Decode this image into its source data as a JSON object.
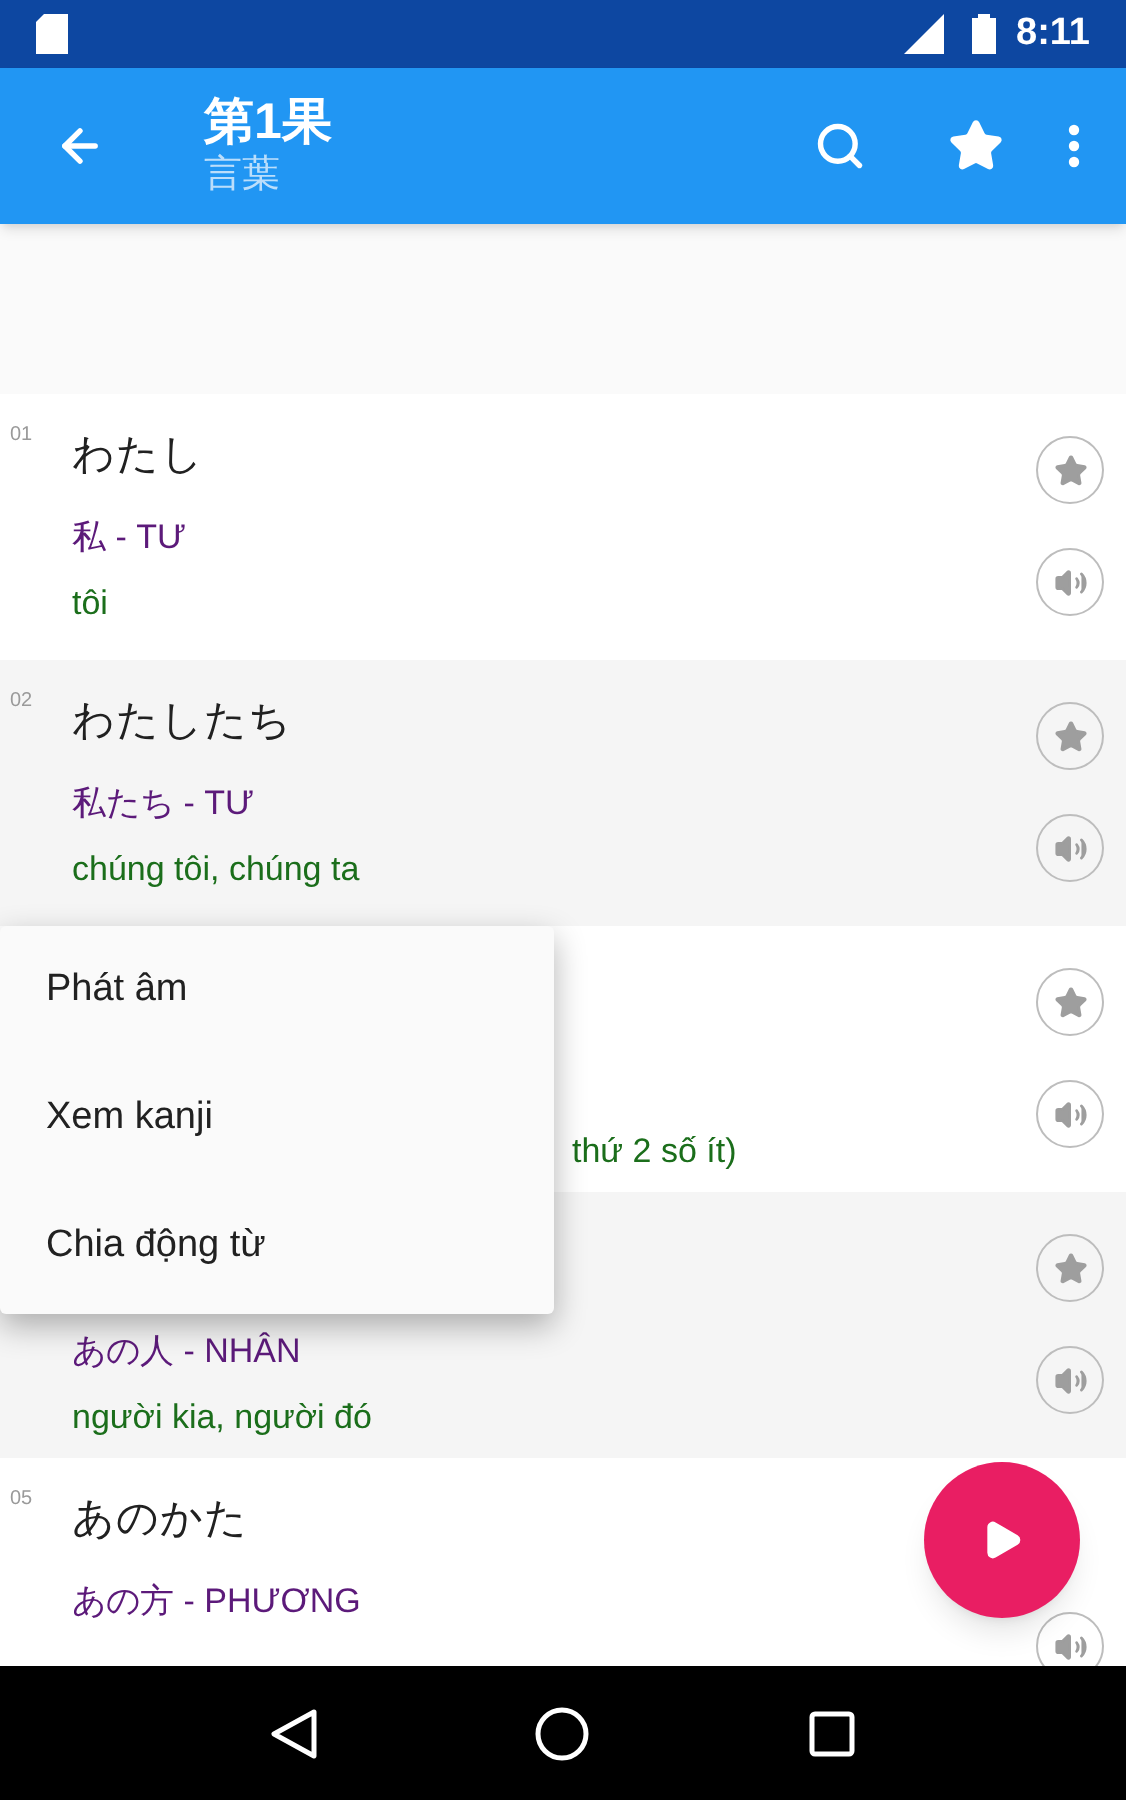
{
  "status_bar": {
    "time": "8:11"
  },
  "app_bar": {
    "title": "第1果",
    "subtitle": "言葉"
  },
  "words": [
    {
      "kind": "entry",
      "number": "01",
      "word": "わたし",
      "kanji": "私 - TƯ",
      "meaning": "tôi"
    },
    {
      "kind": "entry",
      "number": "02",
      "word": "わたしたち",
      "kanji": "私たち - TƯ",
      "meaning": "chúng tôi, chúng ta"
    },
    {
      "kind": "entry",
      "meaning": "thứ 2 số ít)"
    },
    {
      "kind": "entry",
      "kanji": "あの人 - NHÂN",
      "meaning": "người kia, người đó"
    },
    {
      "kind": "under-play-button",
      "number": "05",
      "word": "あのかた",
      "kanji": "あの方 - PHƯƠNG"
    }
  ],
  "menu": {
    "items": [
      "Phát âm",
      "Xem kanji",
      "Chia động từ"
    ]
  }
}
